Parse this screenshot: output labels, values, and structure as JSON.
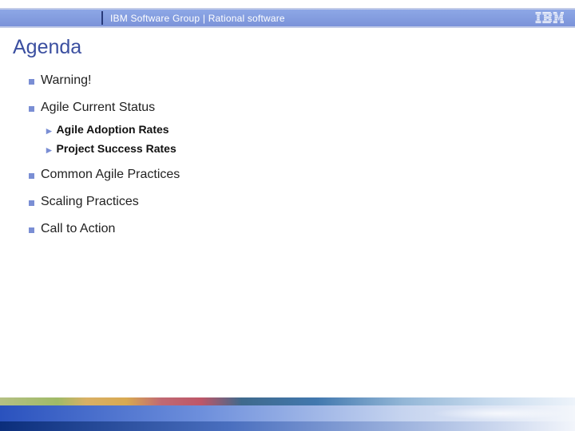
{
  "header": {
    "group_text": "IBM Software Group | Rational software",
    "logo_alt": "IBM"
  },
  "title": "Agenda",
  "agenda": [
    {
      "label": "Warning!",
      "children": []
    },
    {
      "label": "Agile Current Status",
      "children": [
        {
          "label": "Agile Adoption Rates"
        },
        {
          "label": "Project Success Rates"
        }
      ]
    },
    {
      "label": "Common Agile Practices",
      "children": []
    },
    {
      "label": "Scaling Practices",
      "children": []
    },
    {
      "label": "Call to Action",
      "children": []
    }
  ]
}
